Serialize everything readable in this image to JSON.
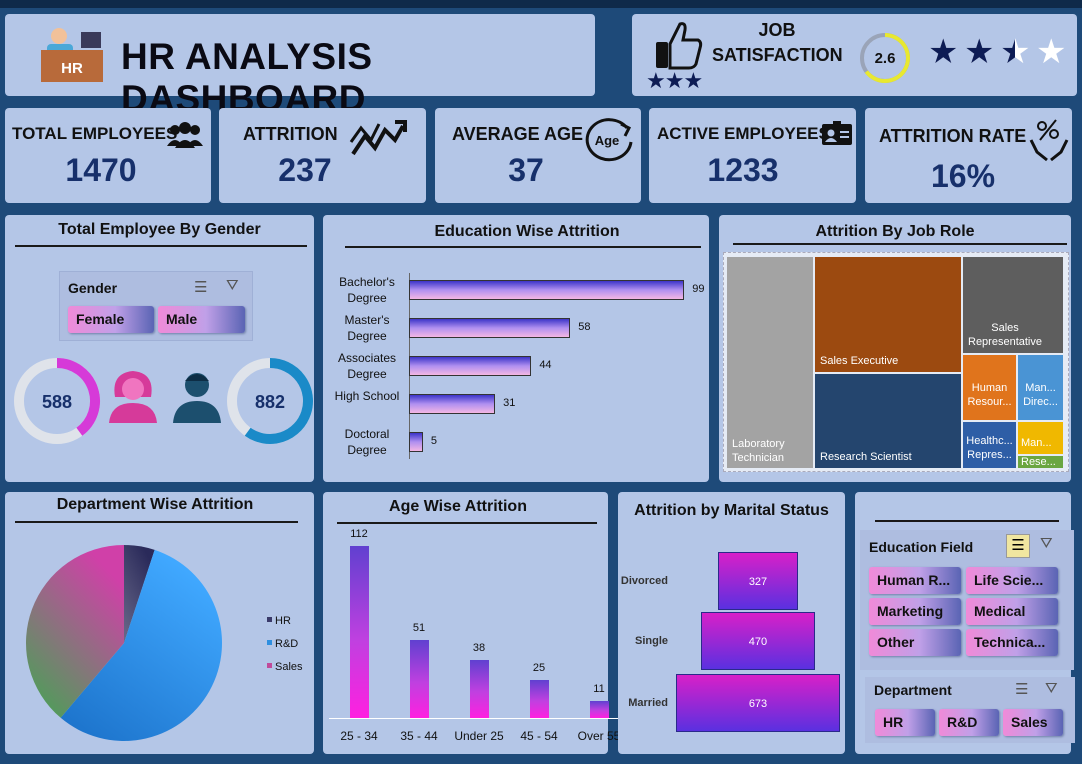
{
  "header": {
    "title": "HR ANALYSIS DASHBOARD",
    "logo_text": "HR"
  },
  "job_satisfaction": {
    "title_line1": "JOB",
    "title_line2": "SATISFACTION",
    "score": "2.6",
    "score_value": 2.6,
    "score_max": 4,
    "stars_filled": 2.5,
    "stars_total": 4
  },
  "kpis": [
    {
      "label": "TOTAL EMPLOYEES",
      "value": "1470",
      "icon": "people-icon"
    },
    {
      "label": "ATTRITION",
      "value": "237",
      "icon": "trend-arrow-icon"
    },
    {
      "label": "AVERAGE AGE",
      "value": "37",
      "icon": "age-icon"
    },
    {
      "label": "ACTIVE EMPLOYEES",
      "value": "1233",
      "icon": "id-card-icon"
    },
    {
      "label": "ATTRITION RATE",
      "value": "16%",
      "icon": "percent-hands-icon"
    }
  ],
  "gender": {
    "title": "Total Employee By Gender",
    "slicer_title": "Gender",
    "female_label": "Female",
    "male_label": "Male",
    "female": "588",
    "male": "882",
    "female_value": 588,
    "male_value": 882,
    "total": 1470
  },
  "education_title": "Education Wise Attrition",
  "age_title": "Age Wise Attrition",
  "job_role_title": "Attrition By Job Role",
  "department_title": "Department Wise Attrition",
  "marital_title": "Attrition by Marital Status",
  "slicers": {
    "education_field_title": "Education Field",
    "education_fields": [
      "Human R...",
      "Life Scie...",
      "Marketing",
      "Medical",
      "Other",
      "Technica..."
    ],
    "department_title": "Department",
    "departments": [
      "HR",
      "R&D",
      "Sales"
    ]
  },
  "chart_data": [
    {
      "type": "bar",
      "orientation": "horizontal",
      "title": "Education Wise Attrition",
      "categories": [
        "Bachelor's Degree",
        "Master's Degree",
        "Associates Degree",
        "High School",
        "Doctoral Degree"
      ],
      "values": [
        99,
        58,
        44,
        31,
        5
      ]
    },
    {
      "type": "bar",
      "title": "Age Wise Attrition",
      "categories": [
        "25 - 34",
        "35 - 44",
        "Under 25",
        "45 - 54",
        "Over 55"
      ],
      "values": [
        112,
        51,
        38,
        25,
        11
      ]
    },
    {
      "type": "treemap",
      "title": "Attrition By Job Role",
      "categories": [
        "Laboratory Technician",
        "Sales Executive",
        "Research Scientist",
        "Sales Representative",
        "Human Resour...",
        "Man... Direc...",
        "Healthc... Repres...",
        "Man...",
        "Rese..."
      ]
    },
    {
      "type": "pie",
      "title": "Department Wise Attrition",
      "categories": [
        "HR",
        "R&D",
        "Sales"
      ],
      "values": [
        12,
        133,
        92
      ],
      "legend": "right",
      "colors": [
        "#3a3a6a",
        "#2e8fe0",
        "#c04a9a"
      ]
    },
    {
      "type": "bar",
      "orientation": "horizontal",
      "title": "Attrition by Marital Status",
      "categories": [
        "Divorced",
        "Single",
        "Married"
      ],
      "values": [
        327,
        470,
        673
      ]
    }
  ]
}
